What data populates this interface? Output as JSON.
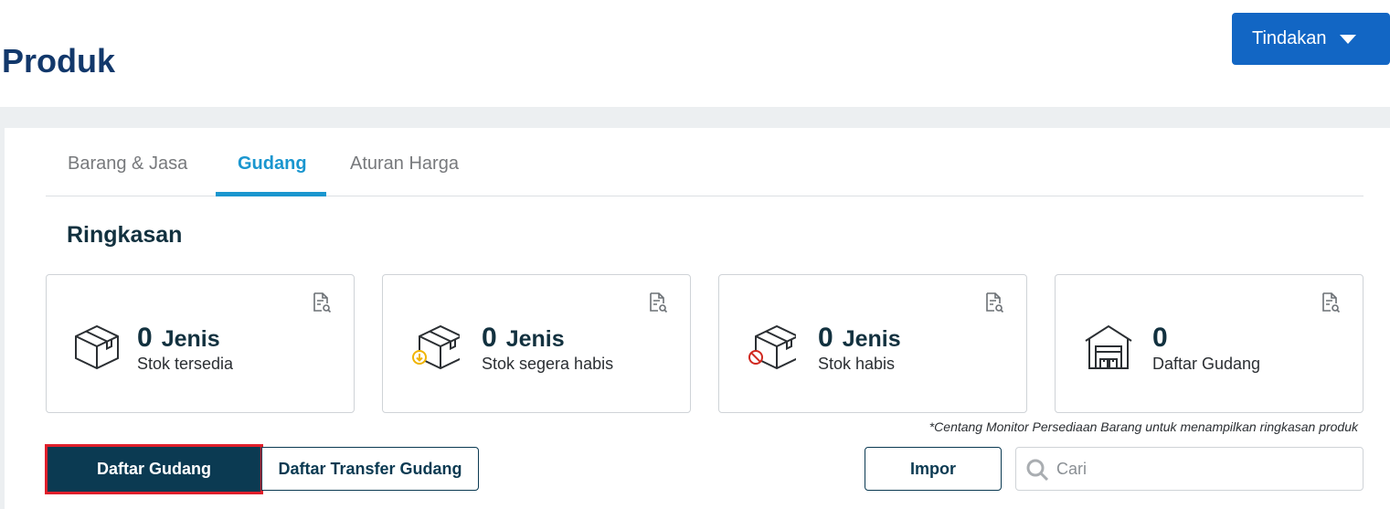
{
  "header": {
    "title": "Produk",
    "action_label": "Tindakan"
  },
  "tabs": [
    {
      "label": "Barang & Jasa",
      "active": false
    },
    {
      "label": "Gudang",
      "active": true
    },
    {
      "label": "Aturan Harga",
      "active": false
    }
  ],
  "summary": {
    "title": "Ringkasan",
    "cards": [
      {
        "value": "0",
        "unit": "Jenis",
        "label": "Stok tersedia",
        "icon": "box-icon"
      },
      {
        "value": "0",
        "unit": "Jenis",
        "label": "Stok segera habis",
        "icon": "box-low-stock-icon"
      },
      {
        "value": "0",
        "unit": "Jenis",
        "label": "Stok habis",
        "icon": "box-out-of-stock-icon"
      },
      {
        "value": "0",
        "unit": "",
        "label": "Daftar Gudang",
        "icon": "warehouse-icon"
      }
    ],
    "footnote": "*Centang Monitor Persediaan Barang untuk menampilkan ringkasan produk"
  },
  "toolbar": {
    "warehouse_list_label": "Daftar Gudang",
    "transfer_list_label": "Daftar Transfer Gudang",
    "import_label": "Impor",
    "search_placeholder": "Cari"
  },
  "colors": {
    "brand": "#12386b",
    "primary_button": "#1266c4",
    "active_tab": "#1a96cf",
    "dark_button": "#0b3a52",
    "selection_outline": "#e01f2b",
    "low_stock_badge": "#f0b400",
    "out_of_stock_badge": "#d0281f"
  }
}
